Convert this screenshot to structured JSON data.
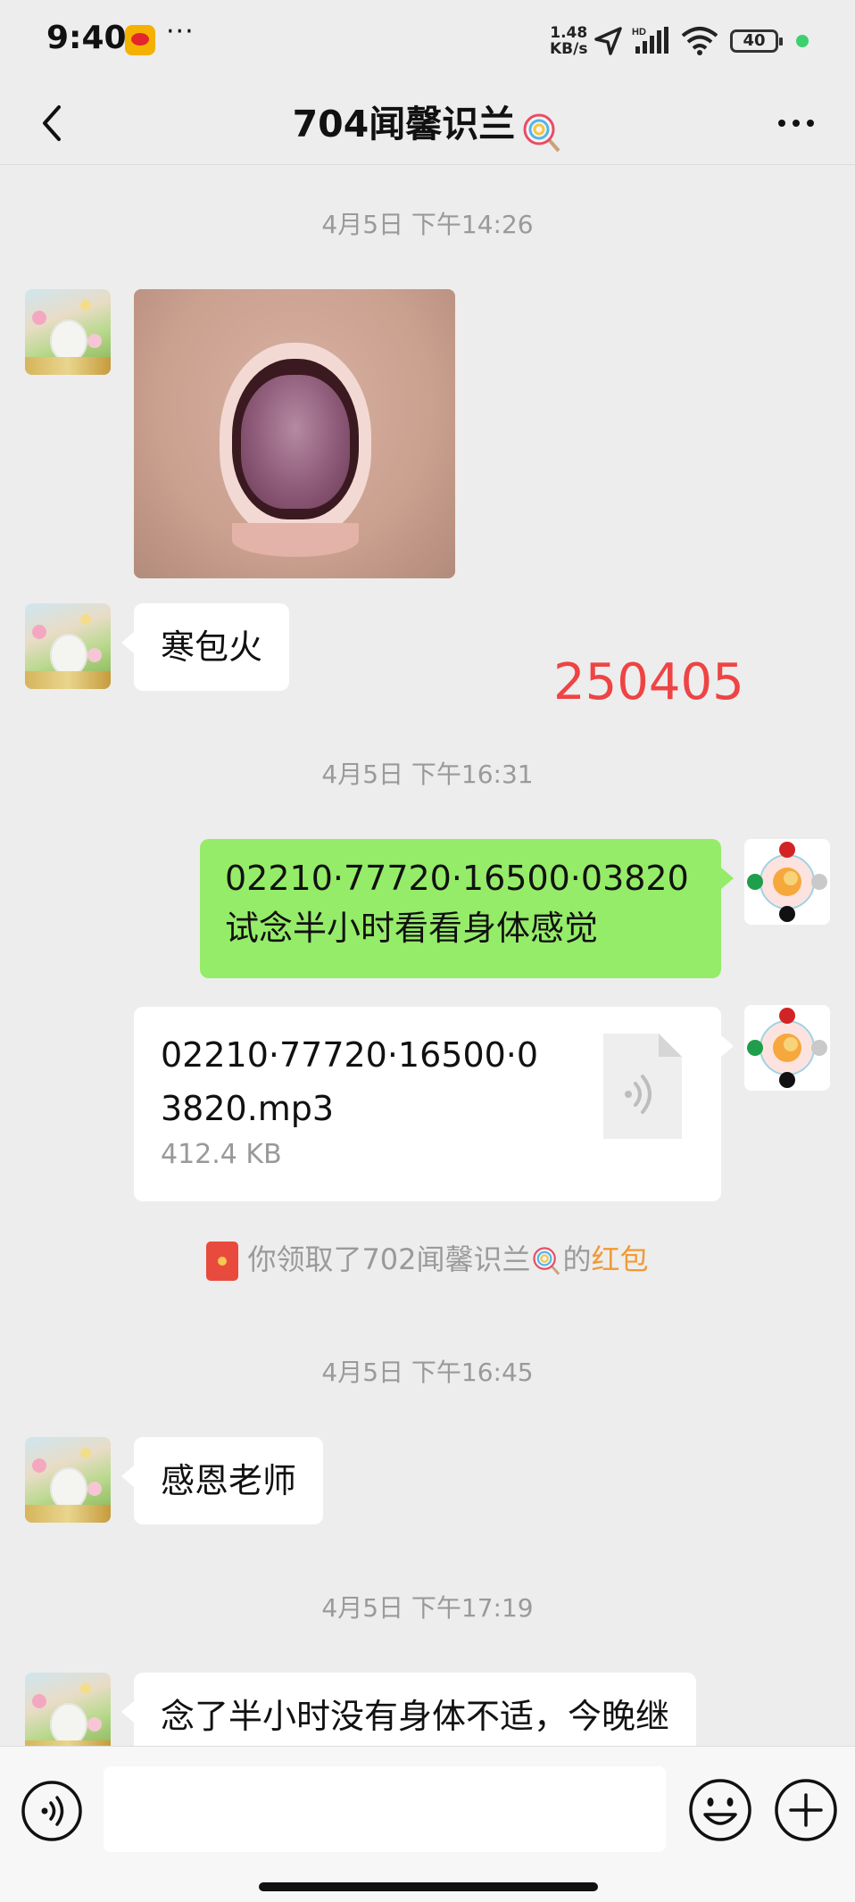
{
  "status_bar": {
    "time": "9:40",
    "more": "···",
    "speed_value": "1.48",
    "speed_unit": "KB/s",
    "battery": "40"
  },
  "header": {
    "title": "704闻馨识兰"
  },
  "messages": {
    "ts1": "4月5日 下午14:26",
    "msg_text1": "寒包火",
    "stamp_number": "250405",
    "ts2": "4月5日 下午16:31",
    "sent_line1": "02210·77720·16500·03820",
    "sent_line2": "试念半小时看看身体感觉",
    "file_name": "02210·77720·16500·03820.mp3",
    "file_size": "412.4 KB",
    "redpacket_pre": "你领取了702闻馨识兰",
    "redpacket_mid": "的",
    "redpacket_link": "红包",
    "ts3": "4月5日 下午16:45",
    "msg_text2": "感恩老师",
    "ts4": "4月5日 下午17:19",
    "msg_text3": "念了半小时没有身体不适，今晚继"
  },
  "colors": {
    "sent_bubble": "#95ec69",
    "stamp": "#ee4444",
    "link": "#f09a37",
    "background": "#ededed"
  },
  "icons": {
    "back": "chevron-left-icon",
    "more": "more-horizontal-icon",
    "voice": "voice-icon",
    "emoji": "emoji-icon",
    "plus": "plus-circle-icon",
    "file": "audio-file-icon",
    "redpacket": "red-packet-icon"
  }
}
